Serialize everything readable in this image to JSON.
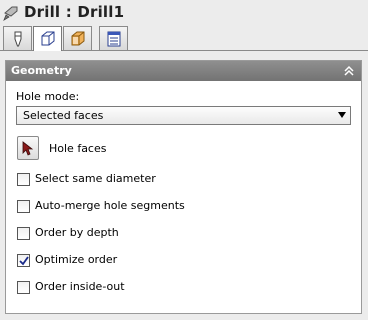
{
  "window": {
    "title": "Drill : Drill1"
  },
  "tabs": [
    {
      "icon": "tool-icon",
      "active": false
    },
    {
      "icon": "geometry-icon",
      "active": true
    },
    {
      "icon": "stock-icon",
      "active": false
    },
    {
      "icon": "parameters-icon",
      "active": false
    }
  ],
  "panel": {
    "title": "Geometry",
    "hole_mode_label": "Hole mode:",
    "hole_mode_value": "Selected faces",
    "hole_faces_label": "Hole faces",
    "options": [
      {
        "label": "Select same diameter",
        "checked": false
      },
      {
        "label": "Auto-merge hole segments",
        "checked": false
      },
      {
        "label": "Order by depth",
        "checked": false
      },
      {
        "label": "Optimize order",
        "checked": true
      },
      {
        "label": "Order inside-out",
        "checked": false
      }
    ]
  },
  "colors": {
    "header": "#7f7f7f",
    "background": "#ececec"
  }
}
